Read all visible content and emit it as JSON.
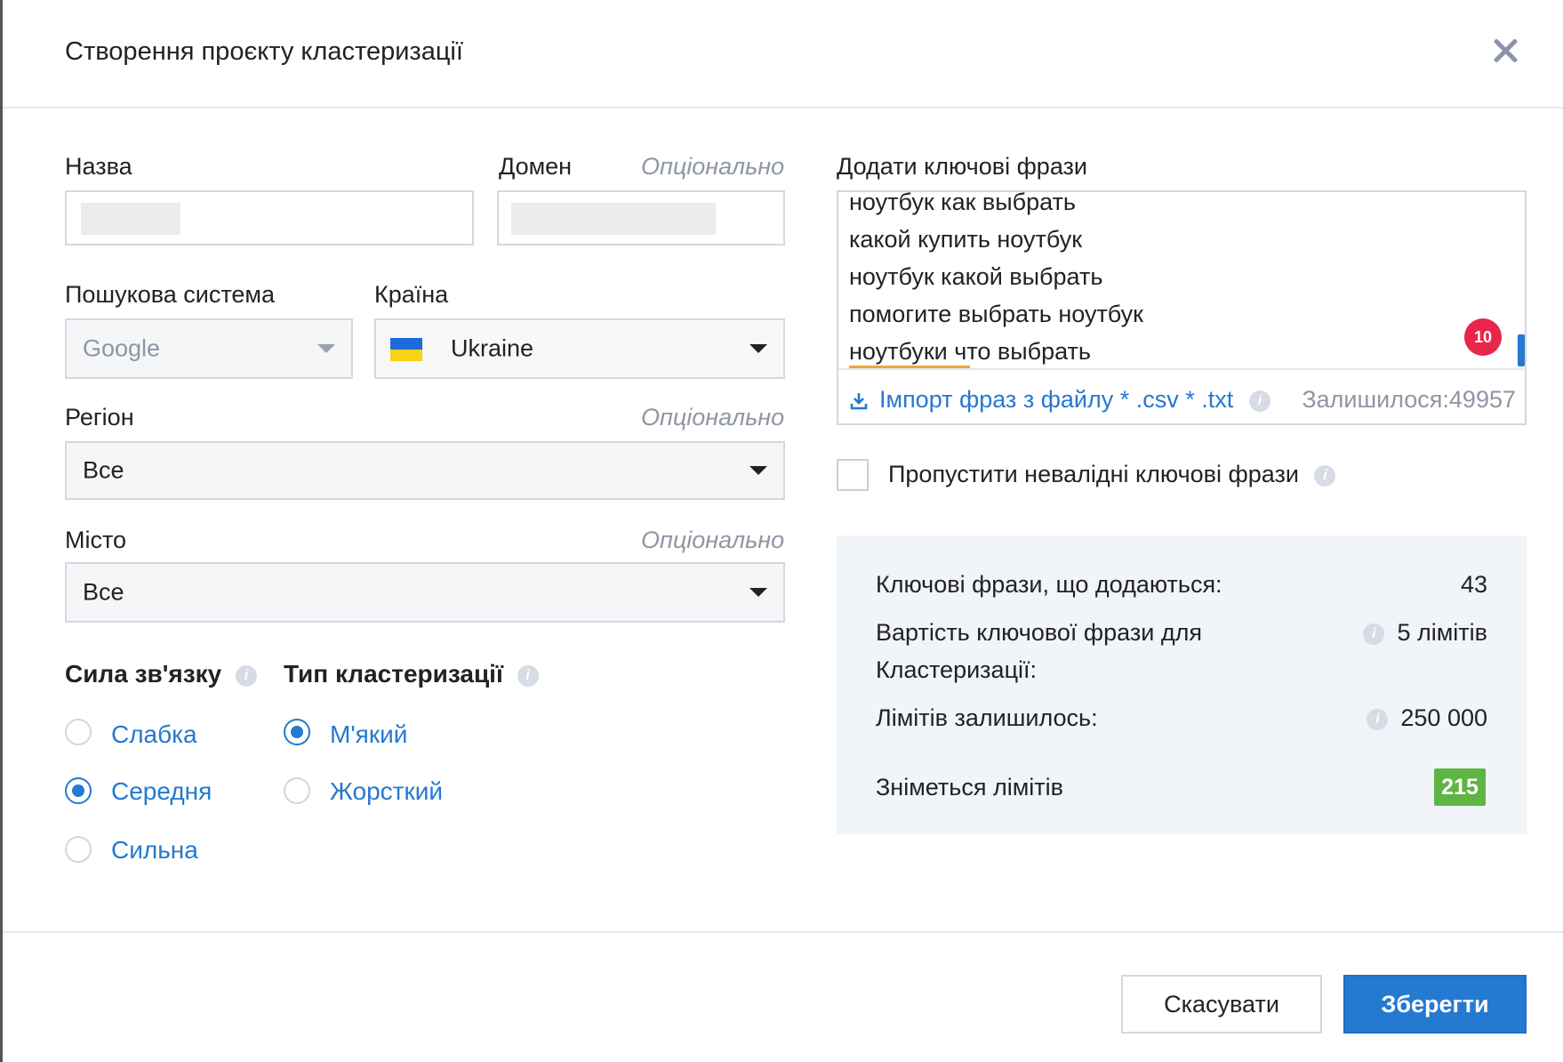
{
  "dialog": {
    "title": "Створення проєкту кластеризації"
  },
  "form": {
    "name_label": "Назва",
    "domain_label": "Домен",
    "optional": "Опціонально",
    "search_engine_label": "Пошукова система",
    "search_engine_value": "Google",
    "country_label": "Країна",
    "country_value": "Ukraine",
    "region_label": "Регіон",
    "region_value": "Все",
    "city_label": "Місто",
    "city_value": "Все"
  },
  "link_strength": {
    "label": "Сила зв'язку",
    "options": [
      "Слабка",
      "Середня",
      "Сильна"
    ],
    "selected": "Середня"
  },
  "cluster_type": {
    "label": "Тип кластеризації",
    "options": [
      "М'який",
      "Жорсткий"
    ],
    "selected": "М'який"
  },
  "keywords": {
    "label": "Додати ключові фрази",
    "lines": [
      "ноутбук как выбрать",
      "какой купить ноутбук",
      "ноутбук какой выбрать",
      "помогите выбрать ноутбук",
      "ноутбуки что выбрать"
    ],
    "badge": "10",
    "import_label": "Імпорт фраз з файлу * .csv * .txt",
    "remaining": "Залишилося:49957",
    "skip_invalid_label": "Пропустити невалідні ключові фрази"
  },
  "summary": {
    "added_label": "Ключові фрази, що додаються:",
    "added_value": "43",
    "cost_label_1": "Вартість ключової фрази для",
    "cost_label_2": "Кластеризації:",
    "cost_value": "5 лімітів",
    "limits_left_label": "Лімітів залишилось:",
    "limits_left_value": "250 000",
    "charge_label": "Зніметься лімітів",
    "charge_value": "215"
  },
  "buttons": {
    "cancel": "Скасувати",
    "save": "Зберегти"
  },
  "colors": {
    "accent": "#2479d0",
    "badge": "#e8264a",
    "charge": "#5fb544"
  }
}
